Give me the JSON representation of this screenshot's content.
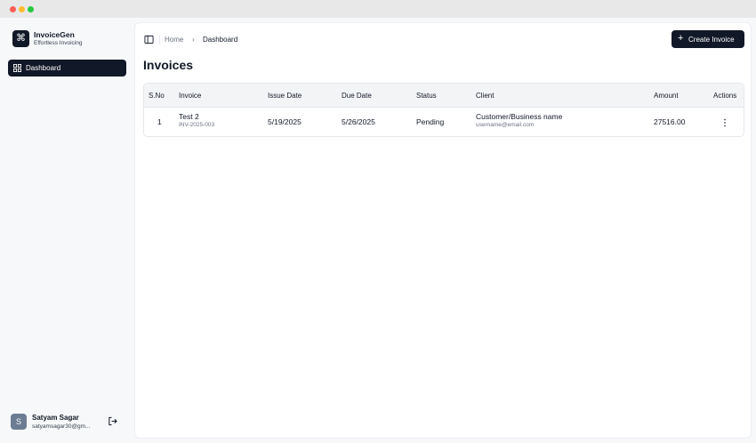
{
  "brand": {
    "name": "InvoiceGen",
    "tagline": "Effortless Invoicing",
    "logo_icon": "command-icon"
  },
  "sidebar": {
    "items": [
      {
        "label": "Dashboard",
        "icon": "grid-icon",
        "active": true
      }
    ]
  },
  "user": {
    "initial": "S",
    "name": "Satyam Sagar",
    "email": "satyamsagar30@gm..."
  },
  "breadcrumb": {
    "home": "Home",
    "current": "Dashboard",
    "separator": "›"
  },
  "header": {
    "create_label": "Create Invoice",
    "plus": "+"
  },
  "page": {
    "title": "Invoices"
  },
  "table": {
    "columns": [
      "S.No",
      "Invoice",
      "Issue Date",
      "Due Date",
      "Status",
      "Client",
      "Amount",
      "Actions"
    ],
    "rows": [
      {
        "sno": "1",
        "invoice_name": "Test 2",
        "invoice_id": "INV-2025-003",
        "issue_date": "5/19/2025",
        "due_date": "5/26/2025",
        "status": "Pending",
        "client_name": "Customer/Business name",
        "client_email": "username@email.com",
        "amount": "27516.00"
      }
    ]
  },
  "colors": {
    "primary": "#111827",
    "sidebar_bg": "#f7f8fa",
    "header_bg": "#f3f4f6"
  }
}
